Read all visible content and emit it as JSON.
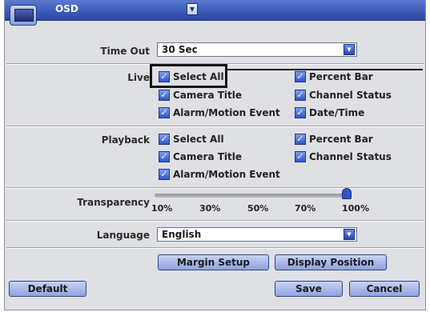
{
  "window": {
    "title": "OSD"
  },
  "timeout": {
    "label": "Time Out",
    "value": "30 Sec"
  },
  "live": {
    "label": "Live",
    "options": [
      {
        "label": "Select All",
        "checked": true
      },
      {
        "label": "Camera Title",
        "checked": true
      },
      {
        "label": "Alarm/Motion Event",
        "checked": true
      },
      {
        "label": "Percent Bar",
        "checked": true
      },
      {
        "label": "Channel Status",
        "checked": true
      },
      {
        "label": "Date/Time",
        "checked": true
      }
    ]
  },
  "playback": {
    "label": "Playback",
    "options": [
      {
        "label": "Select All",
        "checked": true
      },
      {
        "label": "Camera Title",
        "checked": true
      },
      {
        "label": "Alarm/Motion Event",
        "checked": true
      },
      {
        "label": "Percent Bar",
        "checked": true
      },
      {
        "label": "Channel Status",
        "checked": true
      }
    ]
  },
  "transparency": {
    "label": "Transparency",
    "ticks": [
      "10%",
      "30%",
      "50%",
      "70%",
      "100%"
    ],
    "value_percent": 100
  },
  "language": {
    "label": "Language",
    "value": "English"
  },
  "buttons": {
    "margin_setup": "Margin Setup",
    "display_position": "Display Position",
    "default": "Default",
    "save": "Save",
    "cancel": "Cancel"
  },
  "check_glyph": "✓",
  "icons": {
    "window": "monitor-icon",
    "dropdown": "chevron-down-icon"
  },
  "colors": {
    "titlebar": "#3d5bb9",
    "accent": "#2f55c6",
    "panel": "#dfe0e4"
  }
}
